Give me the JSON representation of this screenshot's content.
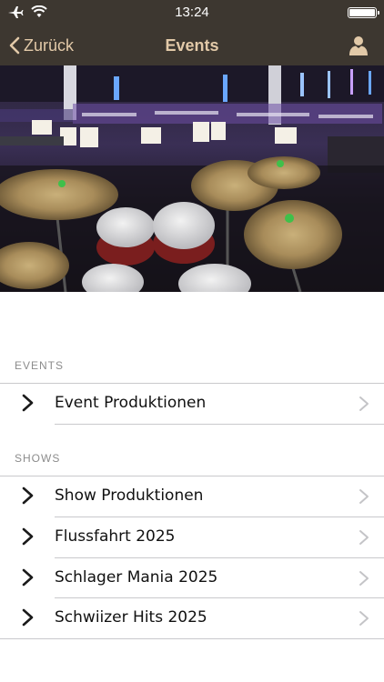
{
  "status_bar": {
    "time": "13:24",
    "icons": [
      "airplane-icon",
      "wifi-icon",
      "battery-icon"
    ]
  },
  "nav": {
    "back_label": "Zurück",
    "title": "Events",
    "user_icon": "user-icon"
  },
  "hero": {
    "icon": "drum-kit-stage-photo"
  },
  "sections": [
    {
      "header": "EVENTS",
      "items": [
        {
          "label": "Event Produktionen"
        }
      ]
    },
    {
      "header": "SHOWS",
      "items": [
        {
          "label": "Show Produktionen"
        },
        {
          "label": "Flussfahrt 2025"
        },
        {
          "label": "Schlager Mania 2025"
        },
        {
          "label": "Schwiizer Hits 2025"
        }
      ]
    }
  ],
  "colors": {
    "bar_background": "#3d3730",
    "accent": "#e2c9a8",
    "chevron_trailing": "#c4c4c7"
  }
}
